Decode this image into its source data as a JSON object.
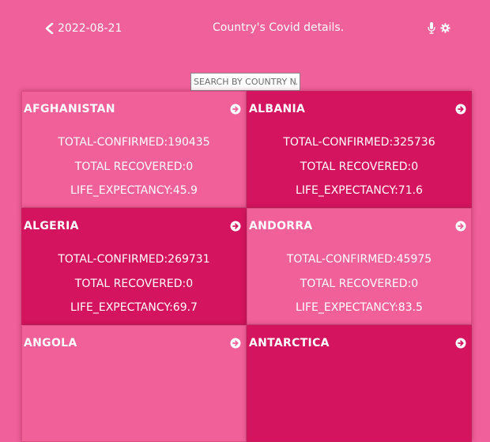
{
  "header": {
    "date": "2022-08-21",
    "title": "Country's Covid details.",
    "icons": {
      "back": "chevron-left-icon",
      "mic": "microphone-icon",
      "settings": "gear-icon"
    }
  },
  "search": {
    "placeholder": "SEARCH BY COUNTRY NAME",
    "value": ""
  },
  "colors": {
    "background": "#f0609a",
    "card_light": "#f2609a",
    "card_dark": "#d4145e"
  },
  "countries": [
    {
      "name": "AFGHANISTAN",
      "confirmed": "TOTAL-CONFIRMED:190435",
      "recovered": "TOTAL RECOVERED:0",
      "life": "LIFE_EXPECTANCY:45.9"
    },
    {
      "name": "ALBANIA",
      "confirmed": "TOTAL-CONFIRMED:325736",
      "recovered": "TOTAL RECOVERED:0",
      "life": "LIFE_EXPECTANCY:71.6"
    },
    {
      "name": "ALGERIA",
      "confirmed": "TOTAL-CONFIRMED:269731",
      "recovered": "TOTAL RECOVERED:0",
      "life": "LIFE_EXPECTANCY:69.7"
    },
    {
      "name": "ANDORRA",
      "confirmed": "TOTAL-CONFIRMED:45975",
      "recovered": "TOTAL RECOVERED:0",
      "life": "LIFE_EXPECTANCY:83.5"
    },
    {
      "name": "ANGOLA",
      "confirmed": "",
      "recovered": "",
      "life": ""
    },
    {
      "name": "ANTARCTICA",
      "confirmed": "",
      "recovered": "",
      "life": ""
    }
  ]
}
